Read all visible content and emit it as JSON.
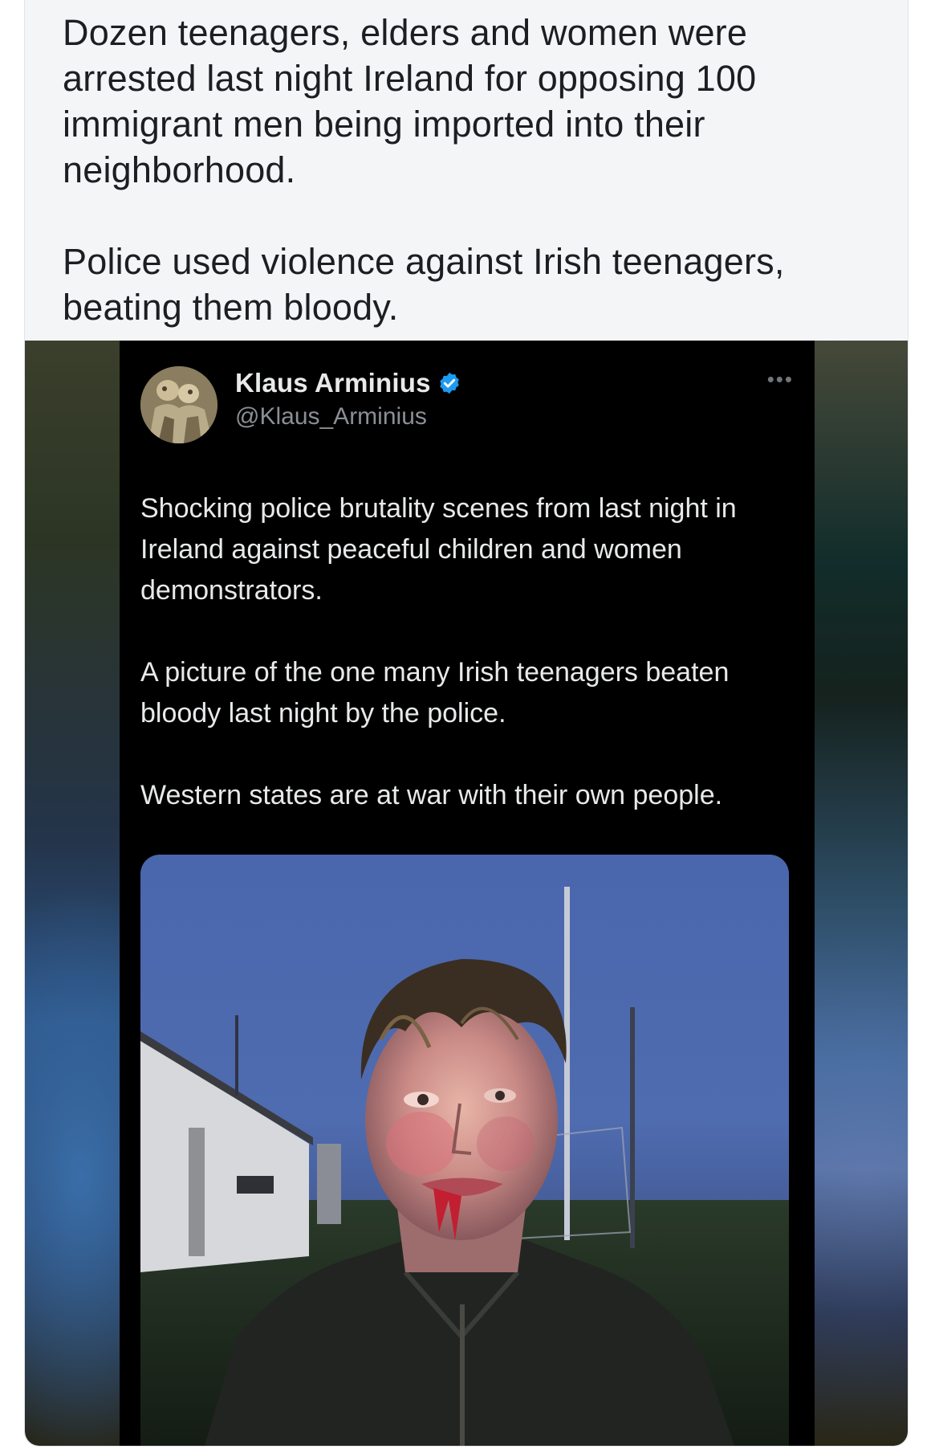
{
  "post": {
    "paragraphs": [
      "Dozen teenagers, elders and women were arrested last night Ireland for opposing 100 immigrant men being imported into their neighborhood.",
      "Police used violence against Irish teenagers, beating them bloody."
    ]
  },
  "embedded_tweet": {
    "author_name": "Klaus Arminius",
    "author_handle": "@Klaus_Arminius",
    "verified_icon": "verified-badge-icon",
    "more_icon": "more-options-icon",
    "more_glyph": "•••",
    "paragraphs": [
      "Shocking police brutality scenes from last night in Ireland against peaceful children and women demonstrators.",
      "A picture of the one many Irish teenagers beaten bloody last night by the police.",
      "Western states are at war with their own people."
    ],
    "photo_icon": "photo-image",
    "colors": {
      "background": "#000000",
      "text": "#e7e9ea",
      "handle": "#8b8f94",
      "verified": "#1d9bf0"
    }
  },
  "colors": {
    "card_background": "#f4f5f7",
    "post_text": "#1e1e22"
  }
}
